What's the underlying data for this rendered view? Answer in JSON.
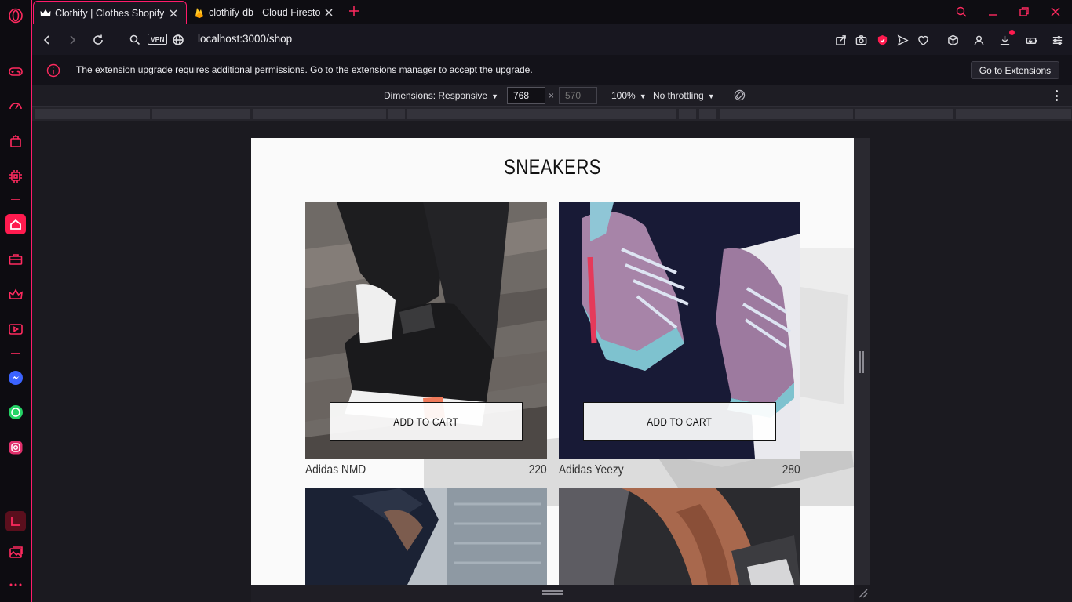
{
  "browser": {
    "tabs": [
      {
        "label": "Clothify | Clothes Shopify",
        "active": true,
        "favicon": "crown-icon"
      },
      {
        "label": "clothify-db - Cloud Firestore",
        "active": false,
        "favicon": "firebase-icon"
      }
    ],
    "url": "localhost:3000/shop",
    "vpn_label": "VPN",
    "accent_color": "#ff1b4f"
  },
  "infobar": {
    "message": "The extension upgrade requires additional permissions. Go to the extensions manager to accept the upgrade.",
    "button_label": "Go to Extensions"
  },
  "devtools": {
    "dimensions_label": "Dimensions: Responsive",
    "width": "768",
    "times": "×",
    "height": "570",
    "zoom": "100%",
    "throttling": "No throttling"
  },
  "shop": {
    "section_title": "SNEAKERS",
    "add_to_cart_label": "ADD TO CART",
    "products": [
      {
        "name": "Adidas NMD",
        "price": "220"
      },
      {
        "name": "Adidas Yeezy",
        "price": "280"
      }
    ]
  }
}
